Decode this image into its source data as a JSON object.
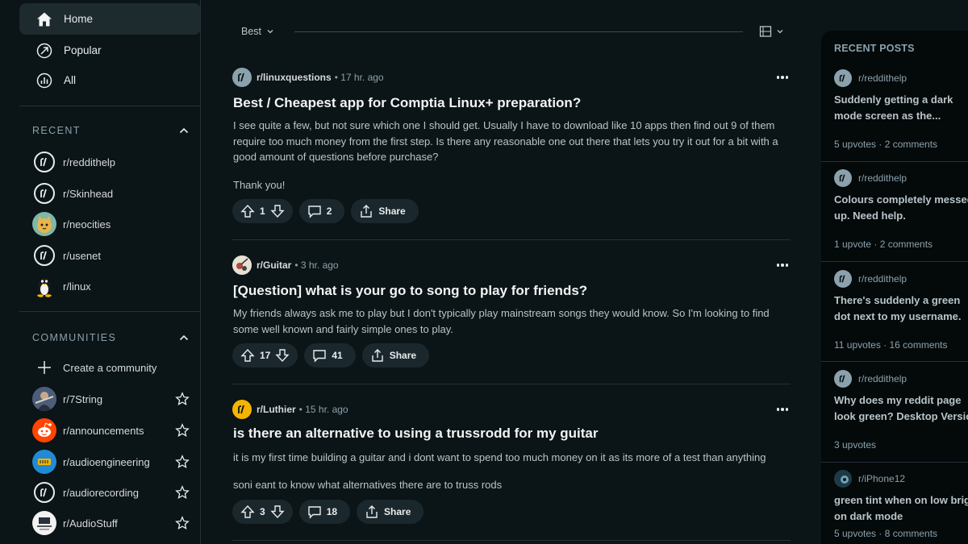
{
  "nav": {
    "home": "Home",
    "popular": "Popular",
    "all": "All"
  },
  "recent": {
    "heading": "RECENT",
    "items": [
      "r/reddithelp",
      "r/Skinhead",
      "r/neocities",
      "r/usenet",
      "r/linux"
    ]
  },
  "communities": {
    "heading": "COMMUNITIES",
    "create": "Create a community",
    "items": [
      "r/7String",
      "r/announcements",
      "r/audioengineering",
      "r/audiorecording",
      "r/AudioStuff"
    ]
  },
  "feed": {
    "sort_label": "Best",
    "posts": [
      {
        "subreddit": "r/linuxquestions",
        "time": "• 17 hr. ago",
        "title": "Best / Cheapest app for Comptia Linux+ preparation?",
        "body1": "I see quite a few, but not sure which one I should get. Usually I have to download like 10 apps then find out 9 of them require too much money from the first step. Is there any reasonable one out there that lets you try it out for a bit with a good amount of questions before purchase?",
        "body2": "Thank you!",
        "votes": "1",
        "comments": "2",
        "share": "Share"
      },
      {
        "subreddit": "r/Guitar",
        "time": "• 3 hr. ago",
        "title": "[Question] what is your go to song to play for friends?",
        "body1": "My friends always ask me to play but I don't typically play mainstream songs they would know. So I'm looking to find some well known and fairly simple ones to play.",
        "body2": "",
        "votes": "17",
        "comments": "41",
        "share": "Share"
      },
      {
        "subreddit": "r/Luthier",
        "time": "• 15 hr. ago",
        "title": "is there an alternative to using a trussrodd for my guitar",
        "body1": "it is my first time building a guitar and i dont want to spend too much money on it as its more of a test than anything",
        "body2": "soni eant to know what alternatives there are to truss rods",
        "votes": "3",
        "comments": "18",
        "share": "Share"
      }
    ]
  },
  "recent_posts": {
    "heading": "RECENT POSTS",
    "items": [
      {
        "subreddit": "r/reddithelp",
        "title1": "Suddenly getting a dark",
        "title2": "mode screen as the...",
        "stats": "5 upvotes · 2 comments"
      },
      {
        "subreddit": "r/reddithelp",
        "title1": "Colours completely messed",
        "title2": "up. Need help.",
        "stats": "1 upvote · 2 comments"
      },
      {
        "subreddit": "r/reddithelp",
        "title1": "There's suddenly a green",
        "title2": "dot next to my username.",
        "stats": "11 upvotes · 16 comments"
      },
      {
        "subreddit": "r/reddithelp",
        "title1": "Why does my reddit page",
        "title2": "look green? Desktop Version",
        "stats": "3 upvotes"
      },
      {
        "subreddit": "r/iPhone12",
        "title1": "green tint when on low brightness",
        "title2": "on dark mode",
        "stats": "5 upvotes · 8 comments"
      }
    ]
  },
  "colors": {
    "background": "#0b1416",
    "active_nav": "#1d2a2e",
    "pill": "#1a282d",
    "muted_text": "#8ba2ad",
    "reddit_orange": "#ff4500",
    "luthier_yellow": "#f5b400"
  }
}
